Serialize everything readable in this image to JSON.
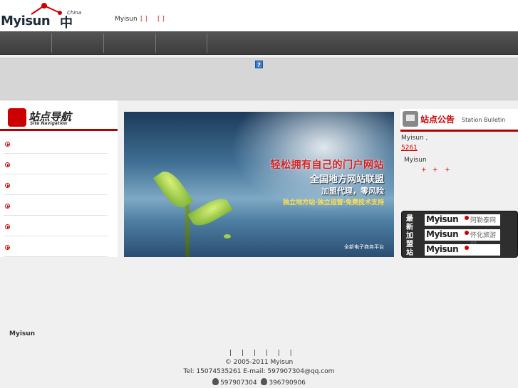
{
  "brand": {
    "logo_word": "Myisun",
    "logo_cn": "中国",
    "logo_small": "China",
    "site_name": "Myisun",
    "bracket_1": "[ ]",
    "bracket_2": "[ ]"
  },
  "banner_strip": {
    "help_glyph": "?"
  },
  "left_nav": {
    "title": "站点导航",
    "subtitle": "Site Navigation",
    "items": [
      "",
      "",
      "",
      "",
      "",
      ""
    ]
  },
  "hero": {
    "line1": "轻松拥有自己的门户网站",
    "line2": "全国地方网站联盟",
    "line3": "加盟代理，零风险",
    "line4": "独立地方站·独立运营·免费技术支持",
    "line5": "全新电子商务平台"
  },
  "bulletin": {
    "title": "站点公告",
    "subtitle": "Station Bulletin",
    "line1": "Myisun ,",
    "line2": "5261",
    "line3": "Myisun",
    "plus": "+"
  },
  "new_sites": {
    "label_chars": [
      "最",
      "新",
      "加",
      "盟",
      "站"
    ],
    "cards": [
      {
        "word": "Myisun",
        "cn": "阿勒泰网"
      },
      {
        "word": "Myisun",
        "cn": "怀化旅游网"
      },
      {
        "word": "Myisun",
        "cn": ""
      }
    ]
  },
  "footer": {
    "site_name": "Myisun",
    "link_separators": [
      "|",
      "|",
      "|",
      "|",
      "|",
      "|"
    ],
    "copyright": "© 2005-2011 Myisun",
    "contact": "Tel: 15074535261 E-mail: 597907304@qq.com",
    "qq1": "597907304",
    "qq2": "396790906"
  },
  "colors": {
    "accent": "#b30000",
    "nav": "#444444",
    "link": "#cc0000"
  }
}
